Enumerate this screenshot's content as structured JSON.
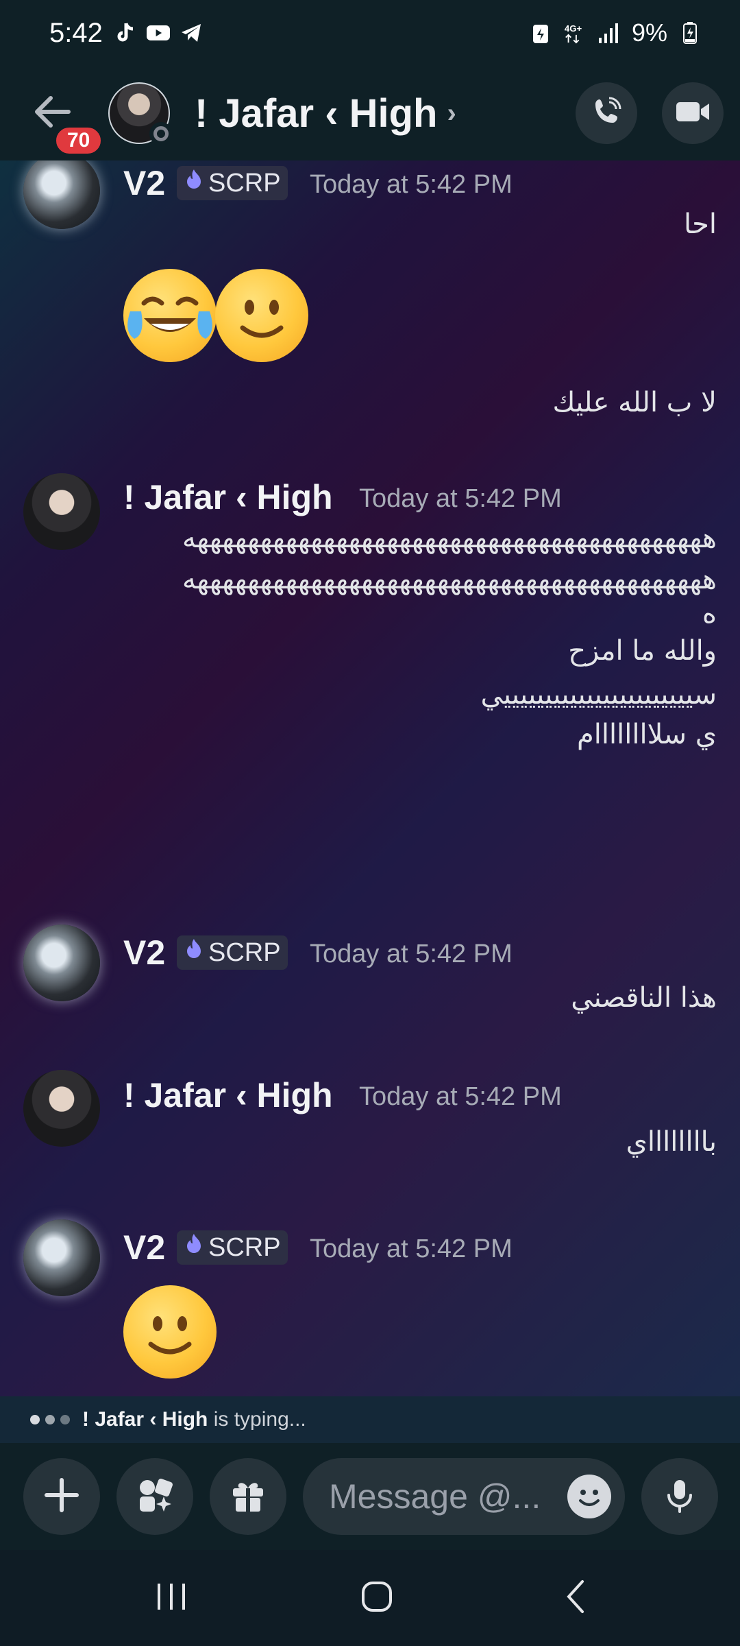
{
  "status_bar": {
    "time": "5:42",
    "battery": "9%",
    "network": "4G+",
    "left_icons": [
      "tiktok-icon",
      "youtube-icon",
      "telegram-icon"
    ],
    "right_icons": [
      "battery-saver-icon",
      "network-4g-icon",
      "signal-icon",
      "battery-icon"
    ]
  },
  "header": {
    "back_icon": "arrow-left-icon",
    "unread_badge": "70",
    "title": "! Jafar ‹ High",
    "chevron": "›",
    "actions": [
      "phone-call-icon",
      "video-call-icon"
    ]
  },
  "tag": {
    "label": "SCRP"
  },
  "messages": [
    {
      "author": "V2",
      "time": "Today at 5:42 PM",
      "lines": [
        "احا"
      ],
      "emojis": [
        "face-with-tears-of-joy",
        "slightly-smiling-face"
      ],
      "lines_after": [
        "لا ب الله عليك"
      ]
    },
    {
      "author": "! Jafar ‹ High",
      "time": "Today at 5:42 PM",
      "lines": [
        "هههههههههههههههههههههههههههههههههههههههههه",
        "هههههههههههههههههههههههههههههههههههههههههه",
        "ه",
        "والله ما امزح",
        "سيييييييييييييييييييييييي",
        "ي سلاااااااام"
      ]
    },
    {
      "author": "V2",
      "time": "Today at 5:42 PM",
      "lines": [
        "هذا الناقصني"
      ]
    },
    {
      "author": "! Jafar ‹ High",
      "time": "Today at 5:42 PM",
      "lines": [
        "بااااااااي"
      ]
    },
    {
      "author": "V2",
      "time": "Today at 5:42 PM",
      "emojis": [
        "slightly-smiling-face"
      ]
    }
  ],
  "typing": {
    "user": "! Jafar ‹ High",
    "suffix": "is typing..."
  },
  "composer": {
    "placeholder": "Message @...",
    "buttons": [
      "plus-icon",
      "apps-icon",
      "gift-icon",
      "microphone-icon"
    ]
  },
  "nav": [
    "recents-icon",
    "home-icon",
    "back-icon"
  ],
  "colors": {
    "badge": "#e0393e",
    "header_bg": "#0f2026",
    "tag_bg": "#2d2f44"
  }
}
